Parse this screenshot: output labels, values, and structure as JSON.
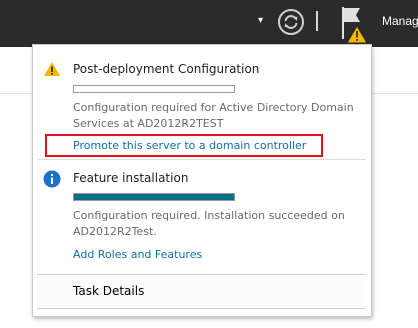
{
  "topbar": {
    "manage_label": "Manag",
    "icons": [
      "chevron-down-icon",
      "refresh-icon",
      "flag-warning-icon"
    ]
  },
  "notifications": [
    {
      "icon": "warning-icon",
      "title": "Post-deployment Configuration",
      "progress": 0.0,
      "description_line1": "Configuration required for Active Directory Domain",
      "description_line2": "Services at AD2012R2TEST",
      "link": "Promote this server to a domain controller"
    },
    {
      "icon": "info-icon",
      "title": "Feature installation",
      "progress": 1.0,
      "description_line1": "Configuration required. Installation succeeded on",
      "description_line2": "AD2012R2Test.",
      "link": "Add Roles and Features"
    }
  ],
  "footer": {
    "task_details_label": "Task Details"
  },
  "colors": {
    "topbar": "#2b2b2b",
    "progress_fill": "#07718c",
    "link": "#0e6ea8",
    "highlight": "#e0101c",
    "warning": "#f5b700",
    "info": "#1a73c9"
  }
}
